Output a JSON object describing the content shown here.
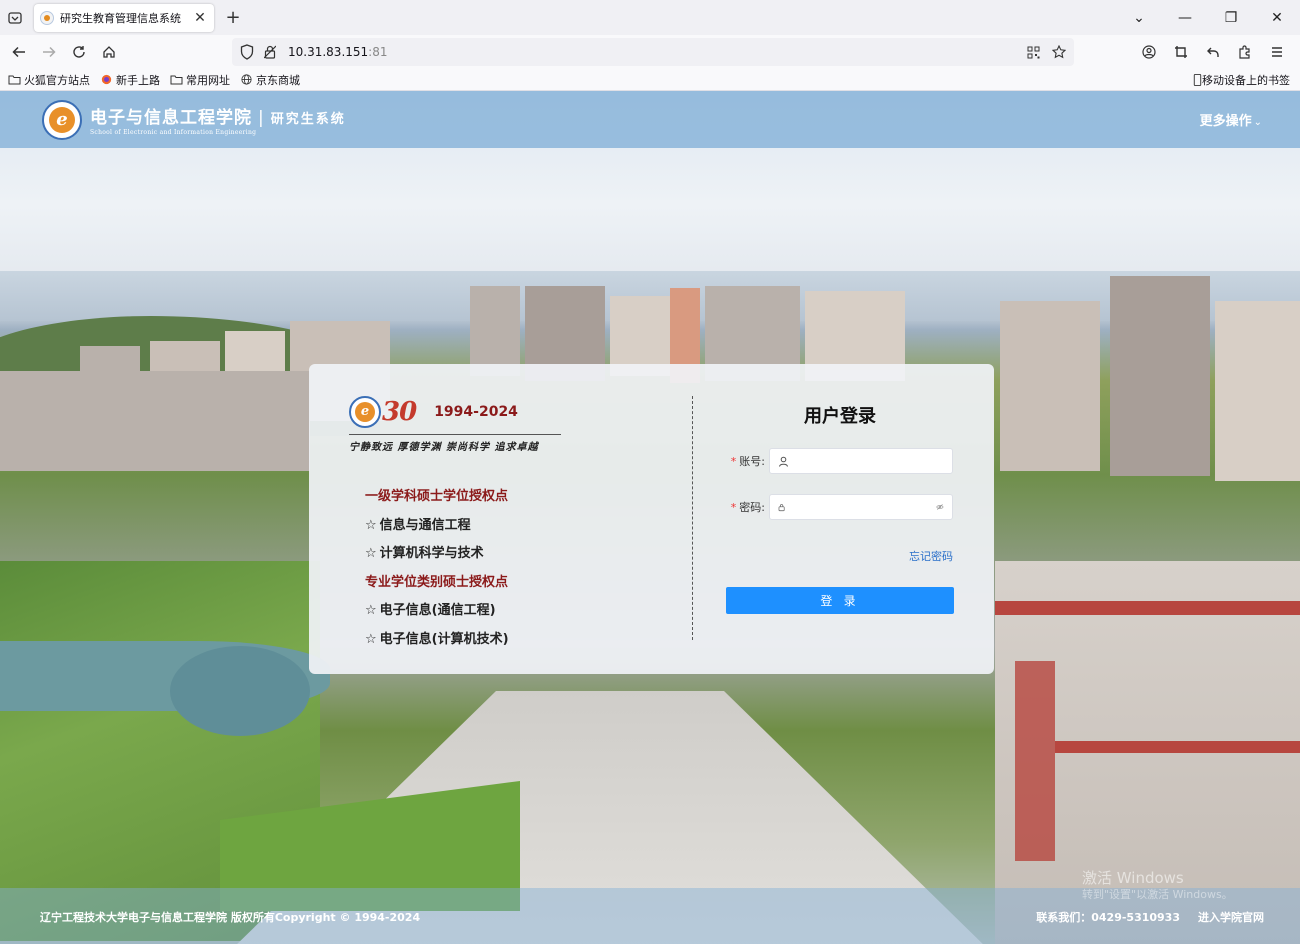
{
  "browser": {
    "tab_title": "研究生教育管理信息系统",
    "url_host": "10.31.83.151",
    "url_port": ":81",
    "bookmarks": [
      "火狐官方站点",
      "新手上路",
      "常用网址",
      "京东商城"
    ],
    "mobile_bookmarks": "移动设备上的书签"
  },
  "header": {
    "school_name": "电子与信息工程学院",
    "separator": "|",
    "system_name": "研究生系统",
    "school_name_en": "School of Electronic and Information Engineering",
    "more_ops": "更多操作"
  },
  "anniversary": {
    "number": "30",
    "years": "1994-2024",
    "motto": "宁静致远 厚德学渊 崇尚科学 追求卓越"
  },
  "authorization": {
    "first_level_head": "一级学科硕士学位授权点",
    "first_level_items": [
      "信息与通信工程",
      "计算机科学与技术"
    ],
    "professional_head": "专业学位类别硕士授权点",
    "professional_items": [
      "电子信息(通信工程)",
      "电子信息(计算机技术)"
    ],
    "star": "☆"
  },
  "login": {
    "title": "用户登录",
    "required_mark": "*",
    "account_label": "账号:",
    "account_value": "",
    "password_label": "密码:",
    "password_value": "",
    "forgot": "忘记密码",
    "submit": "登 录"
  },
  "footer": {
    "copyright": "辽宁工程技术大学电子与信息工程学院 版权所有Copyright © 1994-2024",
    "contact": "联系我们：0429-5310933",
    "official_site": "进入学院官网"
  },
  "watermark": {
    "line1": "激活 Windows",
    "line2": "转到\"设置\"以激活 Windows。"
  },
  "colors": {
    "accent_blue": "#1e90ff",
    "heading_red": "#8b1a1a",
    "link_blue": "#2a6fc9"
  }
}
